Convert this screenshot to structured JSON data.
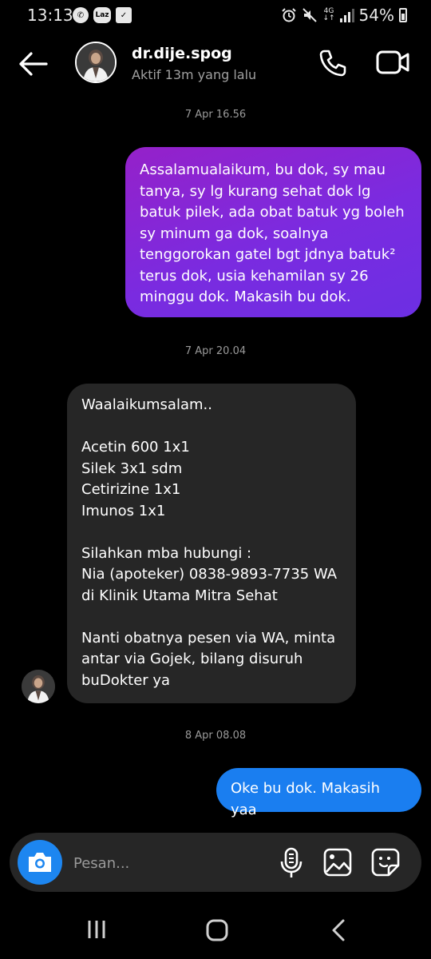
{
  "status_bar": {
    "time": "13:13",
    "laz_label": "Laz",
    "network": "4G",
    "battery": "54%"
  },
  "header": {
    "username": "dr.dije.spog",
    "active_status": "Aktif 13m yang lalu"
  },
  "messages": [
    {
      "timestamp": "7 Apr 16.56",
      "direction": "outgoing",
      "text": "Assalamualaikum, bu dok, sy mau tanya, sy lg kurang sehat dok lg batuk pilek, ada obat batuk yg boleh sy minum ga dok, soalnya tenggorokan gatel bgt jdnya batuk² terus dok, usia kehamilan sy 26 minggu dok. Makasih bu dok."
    },
    {
      "timestamp": "7 Apr 20.04",
      "direction": "incoming",
      "text": "Waalaikumsalam..\n\nAcetin 600 1x1\nSilek 3x1 sdm\nCetirizine 1x1\nImunos 1x1\n\nSilahkan mba hubungi :\nNia (apoteker) 0838-9893-7735 WA\ndi Klinik Utama Mitra Sehat\n\nNanti obatnya pesen via WA, minta antar via Gojek, bilang disuruh buDokter ya"
    },
    {
      "timestamp": "8 Apr 08.08",
      "direction": "outgoing",
      "text": "Oke bu dok. Makasih yaa"
    }
  ],
  "composer": {
    "placeholder": "Pesan..."
  },
  "colors": {
    "outgoing_gradient_start": "#9521c9",
    "outgoing_gradient_end": "#6c2fe3",
    "incoming_bubble": "#262626",
    "outgoing_blue": "#1a7ef0",
    "camera_button": "#1d86f0",
    "background": "#000000"
  },
  "icons": {
    "back": "arrow-left-icon",
    "call": "phone-icon",
    "video": "video-camera-icon",
    "camera": "camera-icon",
    "mic": "microphone-icon",
    "gallery": "image-icon",
    "sticker": "sticker-icon"
  }
}
